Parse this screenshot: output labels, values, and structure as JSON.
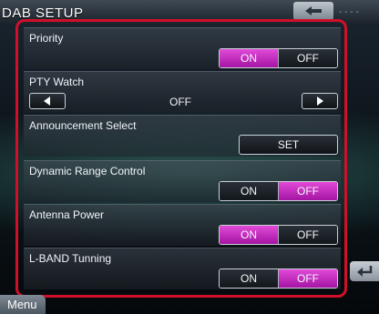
{
  "header": {
    "title": "DAB SETUP",
    "top_right_text": "- - - -"
  },
  "footer": {
    "menu_label": "Menu"
  },
  "settings": {
    "priority": {
      "label": "Priority",
      "on": "ON",
      "off": "OFF",
      "selected": "ON"
    },
    "pty_watch": {
      "label": "PTY Watch",
      "value": "OFF"
    },
    "announcement": {
      "label": "Announcement Select",
      "button": "SET"
    },
    "drc": {
      "label": "Dynamic Range Control",
      "on": "ON",
      "off": "OFF",
      "selected": "OFF"
    },
    "antenna": {
      "label": "Antenna Power",
      "on": "ON",
      "off": "OFF",
      "selected": "ON"
    },
    "lband": {
      "label": "L-BAND Tunning",
      "on": "ON",
      "off": "OFF",
      "selected": "OFF"
    }
  },
  "colors": {
    "active": "#c21fbf",
    "highlight_frame": "#d0102a"
  }
}
